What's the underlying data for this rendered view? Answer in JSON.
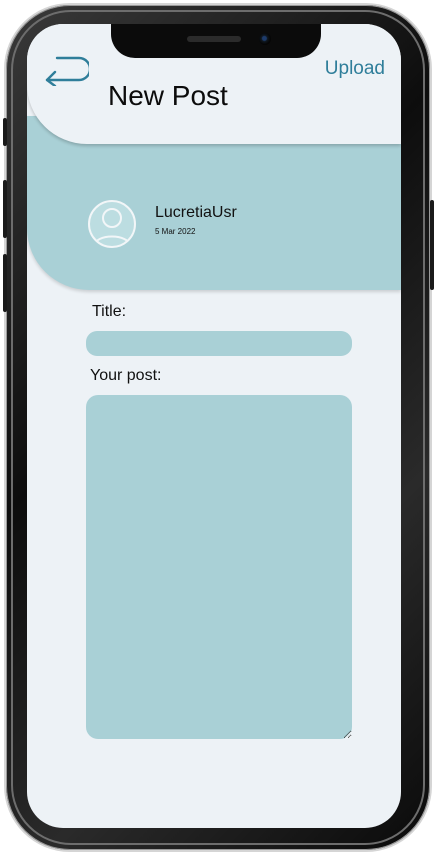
{
  "header": {
    "title": "New Post",
    "upload_label": "Upload",
    "back_icon": "back-arrow-icon"
  },
  "author": {
    "username": "LucretiaUsr",
    "date": "5 Mar 2022",
    "avatar_icon": "user-avatar-icon"
  },
  "form": {
    "title_label": "Title:",
    "title_value": "",
    "post_label": "Your post:",
    "post_value": ""
  },
  "colors": {
    "accent_teal": "#a9d0d6",
    "link_blue": "#2f7e9a",
    "background": "#edf2f6"
  }
}
